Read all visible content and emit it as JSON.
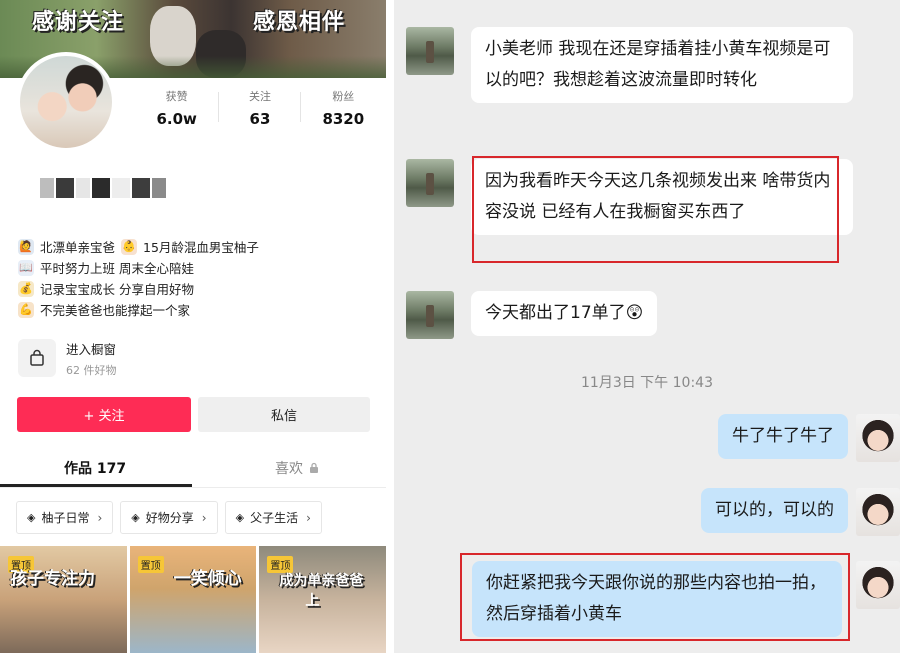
{
  "profile": {
    "banner_left_text": "感谢关注",
    "banner_right_text": "感恩相伴",
    "stats": [
      {
        "label": "获赞",
        "value": "6.0w"
      },
      {
        "label": "关注",
        "value": "63"
      },
      {
        "label": "粉丝",
        "value": "8320"
      }
    ],
    "bio": [
      {
        "icon": "person-icon",
        "text": "北漂单亲宝爸",
        "extra_icon": "baby-icon",
        "extra": "15月龄混血男宝柚子"
      },
      {
        "icon": "book-icon",
        "text": "平时努力上班 周末全心陪娃"
      },
      {
        "icon": "money-bag-icon",
        "text": "记录宝宝成长 分享自用好物"
      },
      {
        "icon": "flexed-arm-icon",
        "text": "不完美爸爸也能撑起一个家"
      }
    ],
    "shop": {
      "title": "进入橱窗",
      "subtitle": "62 件好物"
    },
    "follow_label": "+ 关注",
    "message_label": "私信",
    "tabs": {
      "works": "作品 177",
      "likes": "喜欢"
    },
    "chips": [
      {
        "label": "柚子日常"
      },
      {
        "label": "好物分享"
      },
      {
        "label": "父子生活"
      }
    ],
    "thumbs": [
      {
        "pin": "置顶",
        "caption": "孩子专注力"
      },
      {
        "pin": "置顶",
        "caption": "一笑倾心"
      },
      {
        "pin": "置顶",
        "caption": "成为单亲爸爸",
        "caption2": "上"
      }
    ]
  },
  "chat": {
    "messages_in": [
      {
        "text": "小美老师 我现在还是穿插着挂小黄车视频是可以的吧？我想趁着这波流量即时转化"
      },
      {
        "text": "因为我看昨天今天这几条视频发出来 啥带货内容没说 已经有人在我橱窗买东西了"
      },
      {
        "text": "今天都出了17单了😲"
      }
    ],
    "timestamp": "11月3日  下午 10:43",
    "messages_out": [
      {
        "text": "牛了牛了牛了"
      },
      {
        "text": "可以的，可以的"
      },
      {
        "text": "你赶紧把我今天跟你说的那些内容也拍一拍，然后穿插着小黄车"
      }
    ],
    "highlight_color": "#d8272b"
  }
}
